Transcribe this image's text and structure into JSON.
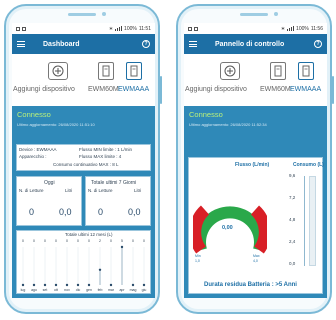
{
  "status_bar": {
    "time_left": "11:51",
    "time_right": "11:56",
    "signal_text": "100%"
  },
  "screen1": {
    "title": "Dashboard",
    "add_device_label": "Aggiungi dispositivo",
    "device1": "EWM60M",
    "device2": "EWMAAA",
    "connection_status": "Connesso",
    "last_update": "Ultimo aggiornamento: 26/08/2020 11:51:10",
    "info": {
      "device": "Device : EWMAAA",
      "flow_min": "Flusso MIN limite : 1 L/min",
      "apparatus": "Apparecchio :",
      "flow_max": "Flusso MAX limite : 4",
      "consumption": "Consumo continuativo MAX : 8 L"
    },
    "today": {
      "title": "Oggi",
      "readings_label": "N. di Letture",
      "liters_label": "Litri",
      "readings": "0",
      "liters": "0,0"
    },
    "last7": {
      "title": "Totale ultimi 7 Giorni",
      "readings_label": "N. di Letture",
      "liters_label": "Litri",
      "readings": "0",
      "liters": "0,0"
    },
    "chart_title": "Totale ultimi 12 mesi (L)"
  },
  "screen2": {
    "title": "Pannello di controllo",
    "add_device_label": "Aggiungi dispositivo",
    "device1": "EWM60M",
    "device2": "EWMAAA",
    "connection_status": "Connesso",
    "last_update": "Ultimo aggiornamento: 26/08/2020 11:52:34",
    "flow_title": "Flusso (L/min)",
    "consumption_title": "Consumo (L)",
    "gauge_value": "0,00",
    "gauge_min": "Min",
    "gauge_max": "Max",
    "gauge_min_val": "1,0",
    "gauge_max_val": "4,0",
    "scale_labels": [
      "9,6",
      "7,2",
      "4,8",
      "2,4",
      "0,0"
    ],
    "battery": "Durata residua Batteria : >5 Anni"
  },
  "chart_data": {
    "type": "bar",
    "title": "Totale ultimi 12 mesi (L)",
    "categories": [
      "lug",
      "ago",
      "set",
      "ott",
      "nov",
      "dic",
      "gen",
      "feb",
      "mar",
      "apr",
      "mag",
      "giu"
    ],
    "values": [
      0,
      0,
      0,
      0,
      0,
      0,
      0,
      2,
      0,
      5,
      0,
      0
    ],
    "ylim": [
      0,
      5
    ]
  }
}
